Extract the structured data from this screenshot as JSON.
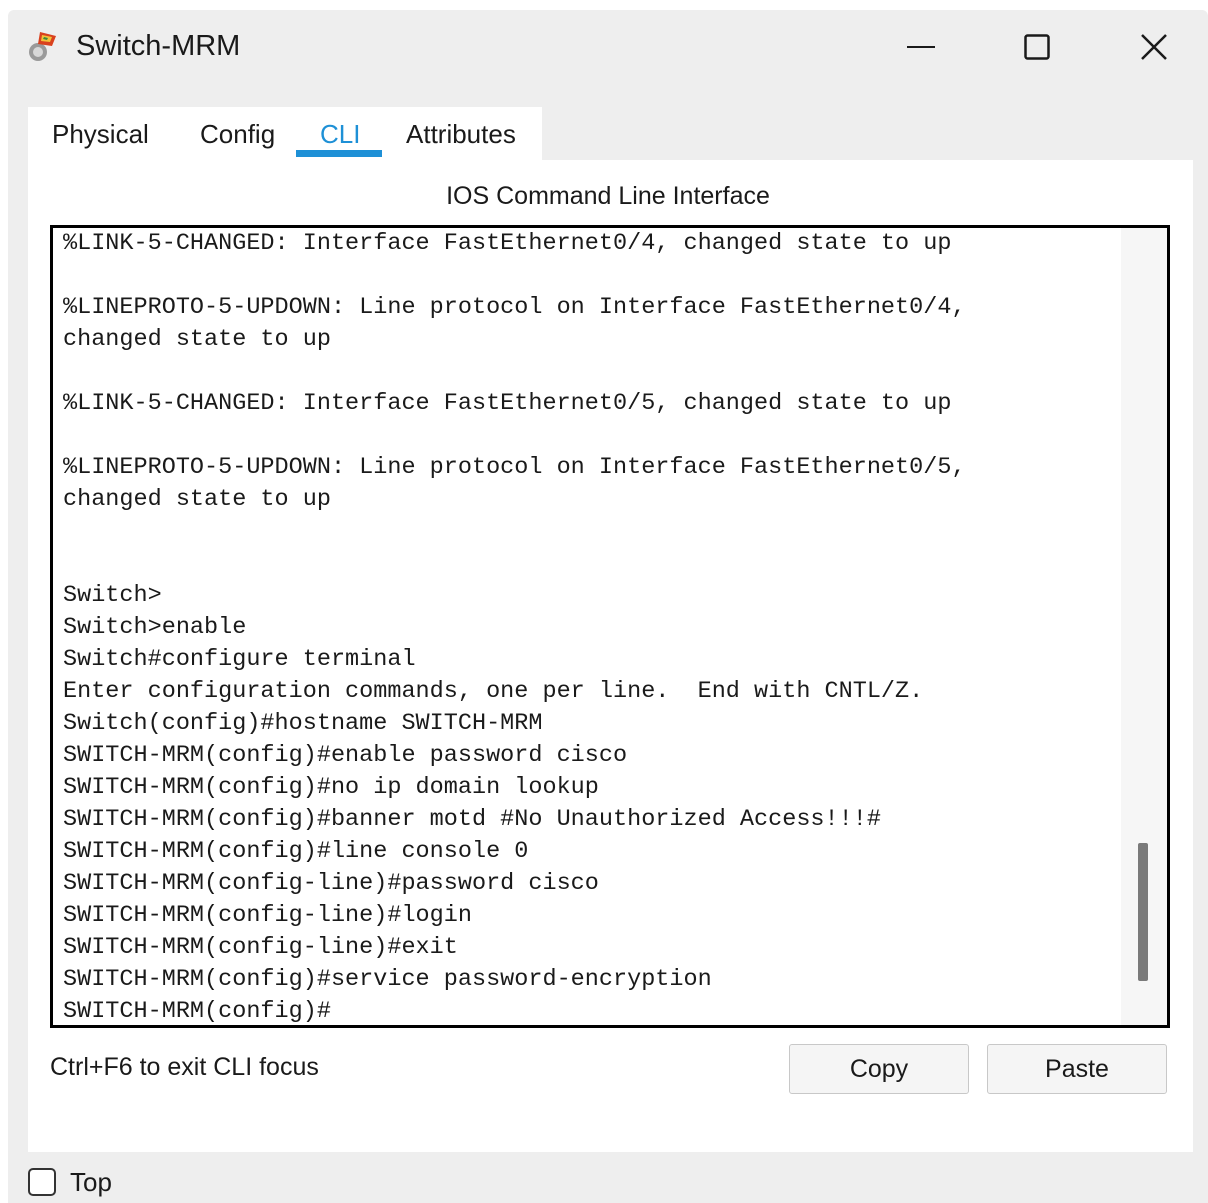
{
  "window": {
    "title": "Switch-MRM",
    "icon": "packet-tracer-icon"
  },
  "tabs": [
    {
      "label": "Physical"
    },
    {
      "label": "Config"
    },
    {
      "label": "CLI",
      "active": true
    },
    {
      "label": "Attributes"
    }
  ],
  "cli": {
    "heading": "IOS Command Line Interface",
    "lines": [
      "%LINK-5-CHANGED: Interface FastEthernet0/4, changed state to up",
      "",
      "%LINEPROTO-5-UPDOWN: Line protocol on Interface FastEthernet0/4,",
      "changed state to up",
      "",
      "%LINK-5-CHANGED: Interface FastEthernet0/5, changed state to up",
      "",
      "%LINEPROTO-5-UPDOWN: Line protocol on Interface FastEthernet0/5,",
      "changed state to up",
      "",
      "",
      "Switch>",
      "Switch>enable",
      "Switch#configure terminal",
      "Enter configuration commands, one per line.  End with CNTL/Z.",
      "Switch(config)#hostname SWITCH-MRM",
      "SWITCH-MRM(config)#enable password cisco",
      "SWITCH-MRM(config)#no ip domain lookup",
      "SWITCH-MRM(config)#banner motd #No Unauthorized Access!!!#",
      "SWITCH-MRM(config)#line console 0",
      "SWITCH-MRM(config-line)#password cisco",
      "SWITCH-MRM(config-line)#login",
      "SWITCH-MRM(config-line)#exit",
      "SWITCH-MRM(config)#service password-encryption",
      "SWITCH-MRM(config)#"
    ]
  },
  "footer": {
    "hint": "Ctrl+F6 to exit CLI focus",
    "copy_label": "Copy",
    "paste_label": "Paste"
  },
  "top_checkbox": {
    "label": "Top",
    "checked": false
  },
  "colors": {
    "accent": "#1e90d6",
    "window_bg": "#eeeeee"
  }
}
